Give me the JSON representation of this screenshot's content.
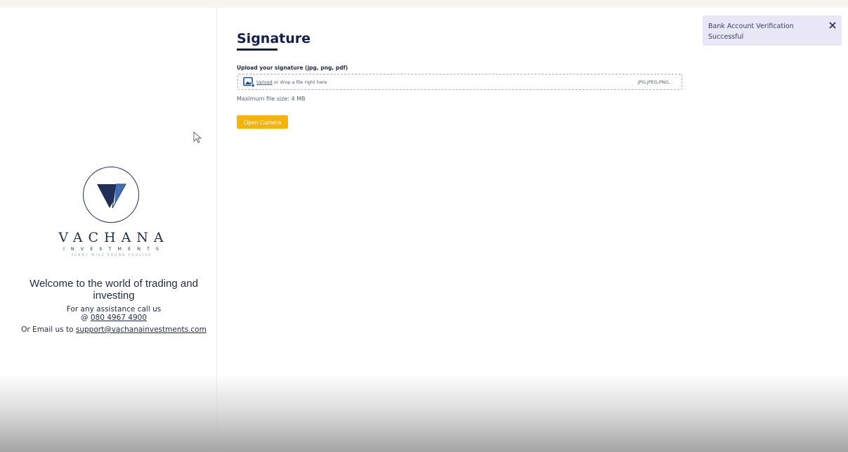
{
  "sidebar": {
    "brand": {
      "name": "VACHANA",
      "sub": "INVESTMENTS",
      "tagline": "PENNY WISE POUND FOOLISH",
      "colors": {
        "navy": "#1f2f55",
        "blue": "#2d5da8"
      }
    },
    "welcome_heading": "Welcome to the world of trading and investing",
    "assist_text": "For any assistance call us",
    "phone_prefix": "@",
    "phone": "080 4967 4900",
    "email_prefix": "Or Email us to",
    "email": "support@vachanainvestments.com"
  },
  "main": {
    "title": "Signature",
    "upload": {
      "label": "Upload your signature (jpg, png, pdf)",
      "link": "Upload",
      "hint": "or drop a file right here",
      "formats": "JPG,JPEG,PNG...",
      "icon": "image-upload-icon"
    },
    "max_size": "Maximum file size: 4 MB",
    "camera_button": "Open Camera",
    "accent_color": "#f5b40b"
  },
  "toast": {
    "message": "Bank Account Verification Successful",
    "close_icon": "close-icon",
    "background": "#e9e6f6"
  }
}
